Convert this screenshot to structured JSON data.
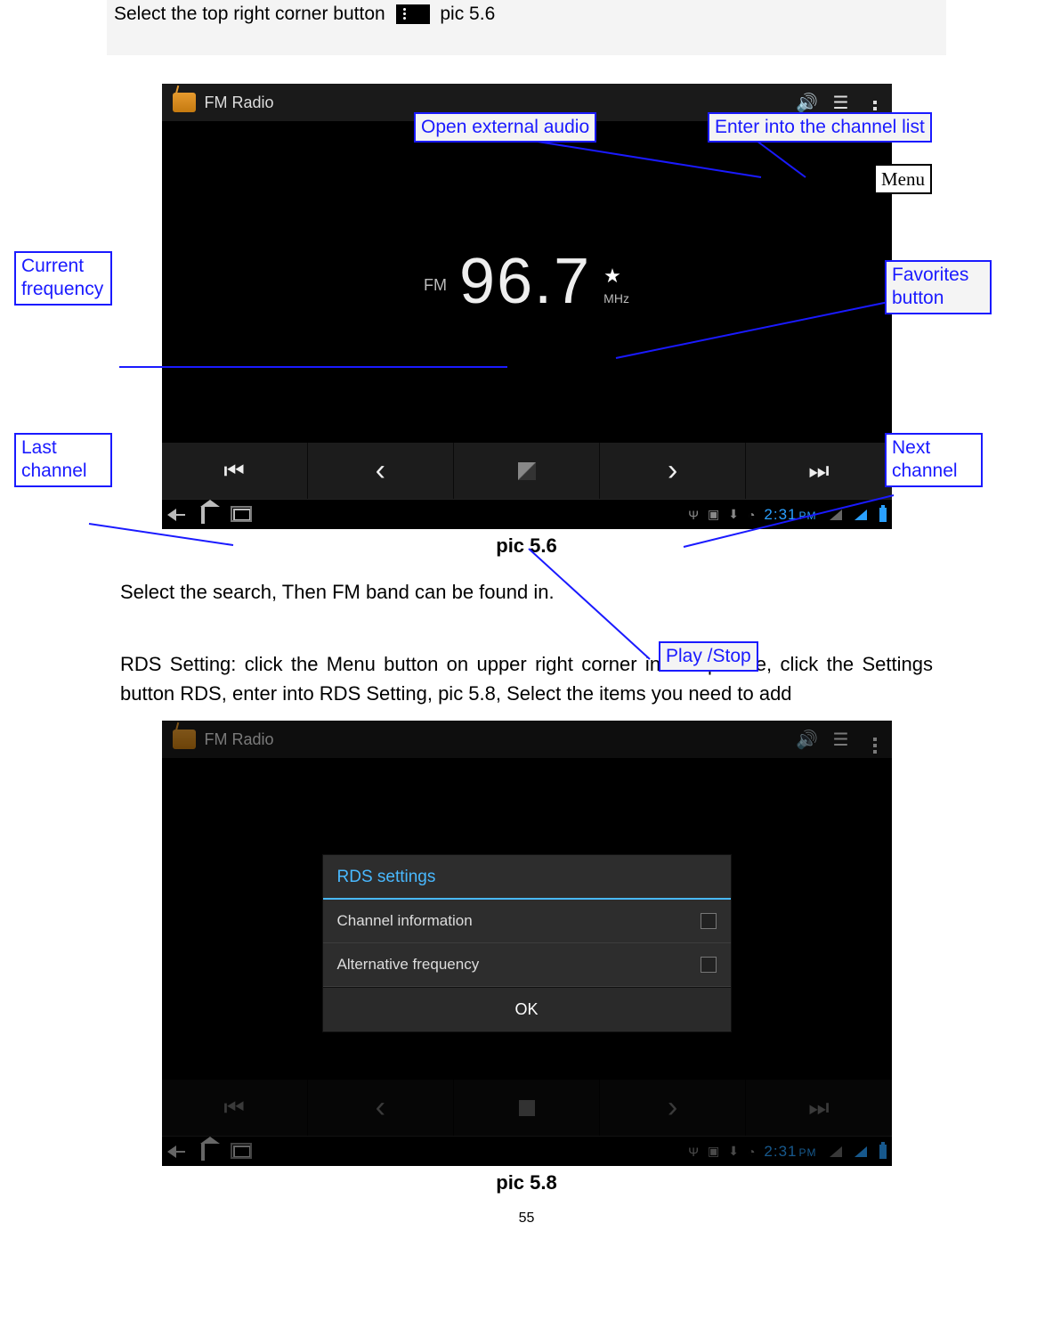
{
  "top_instruction": {
    "lead": "Select the top right corner button",
    "trail": "pic 5.6"
  },
  "callouts": {
    "open_external_audio": "Open external audio",
    "enter_channel_list": "Enter into the channel list",
    "menu": "Menu",
    "current_frequency": "Current frequency",
    "favorites_button": "Favorites button",
    "last_channel": "Last channel",
    "next_channel": "Next channel",
    "play_stop": "Play /Stop"
  },
  "shot1": {
    "app_title": "FM Radio",
    "fm_label": "FM",
    "frequency": "96.7",
    "unit": "MHz",
    "clock": "2:31",
    "ampm": "PM"
  },
  "captions": {
    "pic56": "pic 5.6",
    "pic58": "pic 5.8"
  },
  "paragraphs": {
    "search": "Select the search, Then FM band can be found in.",
    "rds": "RDS Setting: click the Menu button on upper right corner in last picture, click the Settings button RDS, enter into RDS Setting, pic 5.8, Select the items you need to add"
  },
  "shot2": {
    "app_title": "FM Radio",
    "dialog_title": "RDS settings",
    "row1": "Channel information",
    "row2": "Alternative frequency",
    "ok": "OK",
    "clock": "2:31",
    "ampm": "PM"
  },
  "page_number": "55"
}
